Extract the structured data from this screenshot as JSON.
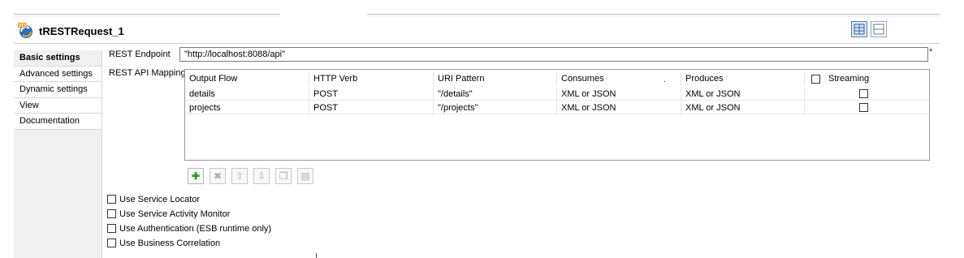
{
  "component": {
    "title": "tRESTRequest_1"
  },
  "sidebar": {
    "items": [
      {
        "label": "Basic settings",
        "active": true
      },
      {
        "label": "Advanced settings",
        "active": false
      },
      {
        "label": "Dynamic settings",
        "active": false
      },
      {
        "label": "View",
        "active": false
      },
      {
        "label": "Documentation",
        "active": false
      }
    ]
  },
  "basic": {
    "endpoint_label": "REST Endpoint",
    "endpoint_value": "\"http://localhost:8088/api\"",
    "dirty_marker": "*",
    "mapping_label": "REST API Mapping"
  },
  "table": {
    "headers": [
      "Output Flow",
      "HTTP Verb",
      "URI Pattern",
      "Consumes",
      "Produces",
      "Streaming"
    ],
    "rows": [
      {
        "output_flow": "details",
        "http_verb": "POST",
        "uri_pattern": "\"/details\"",
        "consumes": "XML or JSON",
        "produces": "XML or JSON",
        "streaming": false
      },
      {
        "output_flow": "projects",
        "http_verb": "POST",
        "uri_pattern": "\"/projects\"",
        "consumes": "XML or JSON",
        "produces": "XML or JSON",
        "streaming": false
      }
    ]
  },
  "toolbar": {
    "buttons": [
      "add-icon",
      "remove-icon",
      "move-up-icon",
      "move-down-icon",
      "copy-icon",
      "paste-icon"
    ]
  },
  "options": [
    {
      "label": "Use Service Locator",
      "checked": false
    },
    {
      "label": "Use Service Activity Monitor",
      "checked": false
    },
    {
      "label": "Use Authentication (ESB runtime only)",
      "checked": false
    },
    {
      "label": "Use Business Correlation",
      "checked": false
    }
  ]
}
